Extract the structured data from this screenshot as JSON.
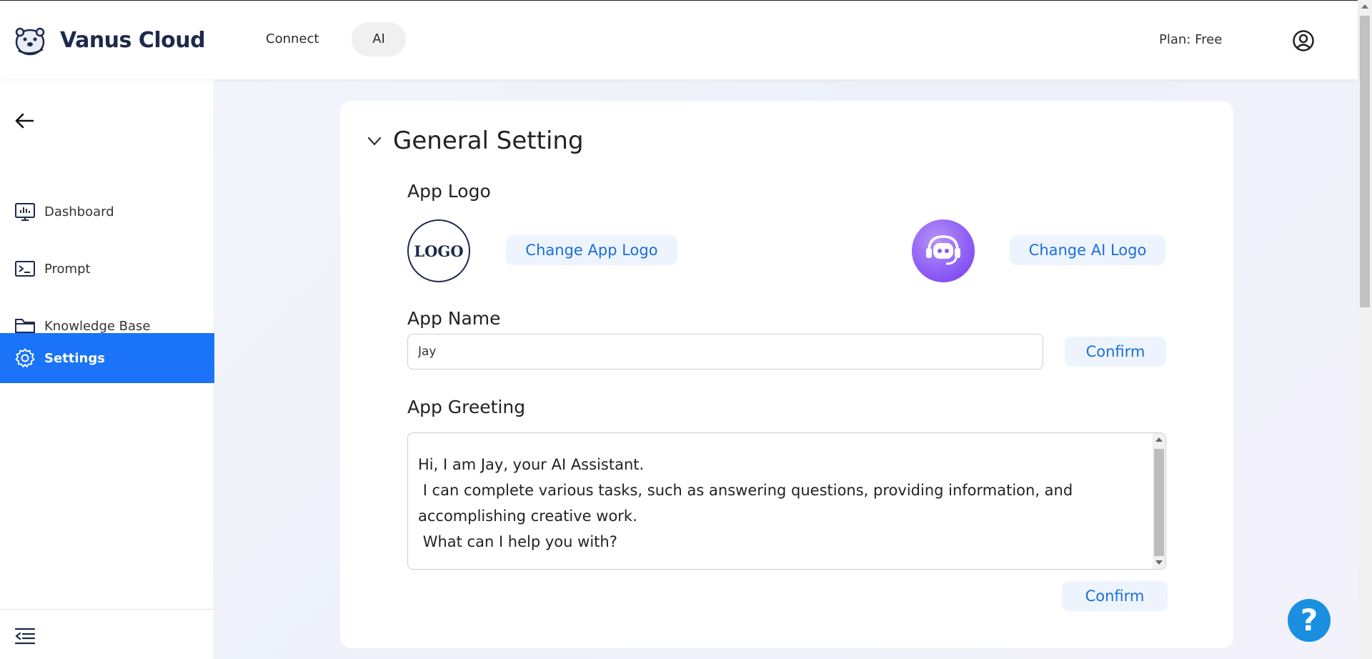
{
  "brand": {
    "name": "Vanus Cloud"
  },
  "nav": {
    "tabs": [
      {
        "label": "Connect"
      },
      {
        "label": "AI"
      }
    ]
  },
  "header": {
    "plan": "Plan: Free"
  },
  "sidebar": {
    "items": [
      {
        "label": "Dashboard",
        "icon": "dashboard-icon"
      },
      {
        "label": "Prompt",
        "icon": "terminal-icon"
      },
      {
        "label": "Knowledge Base",
        "icon": "folder-icon"
      },
      {
        "label": "Settings",
        "icon": "gear-icon",
        "active": true
      }
    ]
  },
  "main": {
    "section_title": "General Setting",
    "app_logo": {
      "label": "App Logo",
      "logo_text": "LOGO",
      "change_app_logo": "Change App Logo",
      "change_ai_logo": "Change AI Logo"
    },
    "app_name": {
      "label": "App Name",
      "value": "Jay",
      "confirm": "Confirm"
    },
    "app_greeting": {
      "label": "App Greeting",
      "value": "Hi, I am Jay, your AI Assistant.\n I can complete various tasks, such as answering questions, providing information, and accomplishing creative work.\n What can I help you with?",
      "confirm": "Confirm"
    }
  },
  "help": {
    "label": "?"
  },
  "colors": {
    "accent": "#1a73f8",
    "button_bg": "#eef4fd",
    "button_text": "#1a6fd8",
    "ai_logo": "#8b5cf6"
  }
}
